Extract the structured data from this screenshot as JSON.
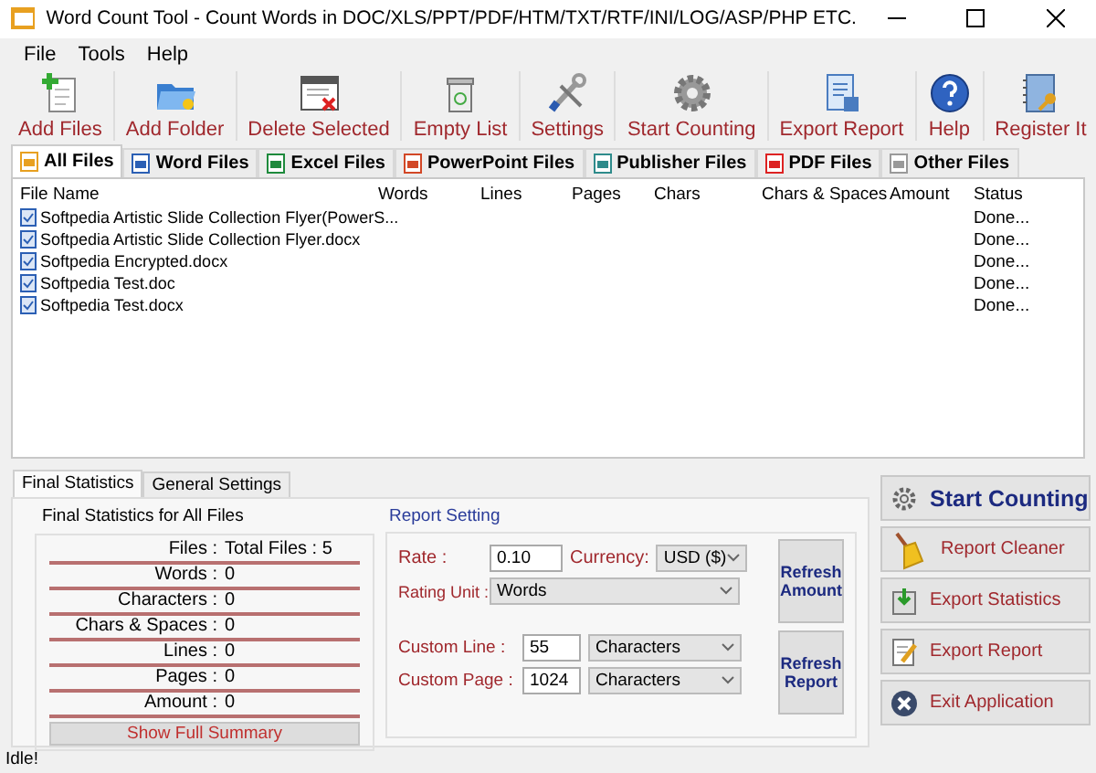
{
  "window": {
    "title": "Word Count Tool - Count Words in DOC/XLS/PPT/PDF/HTM/TXT/RTF/INI/LOG/ASP/PHP ETC."
  },
  "menu": [
    "File",
    "Tools",
    "Help"
  ],
  "toolbar": [
    {
      "label": "Add Files",
      "kind": "add-files"
    },
    {
      "label": "Add Folder",
      "kind": "add-folder"
    },
    {
      "label": "Delete Selected",
      "kind": "delete"
    },
    {
      "label": "Empty List",
      "kind": "empty"
    },
    {
      "label": "Settings",
      "kind": "settings"
    },
    {
      "label": "Start Counting",
      "kind": "start"
    },
    {
      "label": "Export Report",
      "kind": "export"
    },
    {
      "label": "Help",
      "kind": "help"
    },
    {
      "label": "Register It",
      "kind": "register"
    }
  ],
  "file_tabs": [
    {
      "label": "All Files",
      "kind": "all",
      "selected": true
    },
    {
      "label": "Word Files",
      "kind": "word",
      "selected": false
    },
    {
      "label": "Excel Files",
      "kind": "excel",
      "selected": false
    },
    {
      "label": "PowerPoint Files",
      "kind": "powerpoint",
      "selected": false
    },
    {
      "label": "Publisher Files",
      "kind": "publisher",
      "selected": false
    },
    {
      "label": "PDF Files",
      "kind": "pdf",
      "selected": false
    },
    {
      "label": "Other Files",
      "kind": "other",
      "selected": false
    }
  ],
  "table": {
    "columns": [
      "File Name",
      "Words",
      "Lines",
      "Pages",
      "Chars",
      "Chars & Spaces",
      "Amount",
      "Status"
    ],
    "rows": [
      {
        "file_name": "Softpedia Artistic Slide Collection Flyer(PowerS...",
        "status": "Done..."
      },
      {
        "file_name": "Softpedia Artistic Slide Collection Flyer.docx",
        "status": "Done..."
      },
      {
        "file_name": "Softpedia Encrypted.docx",
        "status": "Done..."
      },
      {
        "file_name": "Softpedia Test.doc",
        "status": "Done..."
      },
      {
        "file_name": "Softpedia Test.docx",
        "status": "Done..."
      }
    ]
  },
  "bottom_tabs": [
    {
      "label": "Final Statistics",
      "selected": true
    },
    {
      "label": "General Settings",
      "selected": false
    }
  ],
  "statistics": {
    "title": "Final Statistics for All Files",
    "rows": [
      {
        "label": "Files :",
        "value": "Total Files : 5"
      },
      {
        "label": "Words :",
        "value": "0"
      },
      {
        "label": "Characters :",
        "value": "0"
      },
      {
        "label": "Chars & Spaces :",
        "value": "0"
      },
      {
        "label": "Lines :",
        "value": "0"
      },
      {
        "label": "Pages :",
        "value": "0"
      },
      {
        "label": "Amount :",
        "value": "0"
      }
    ],
    "summary_button": "Show Full Summary"
  },
  "report_setting": {
    "title": "Report Setting",
    "rate": {
      "label": "Rate :",
      "value": "0.10"
    },
    "currency": {
      "label": "Currency:",
      "value": "USD ($)"
    },
    "rating_unit": {
      "label": "Rating Unit :",
      "value": "Words"
    },
    "custom_line": {
      "label": "Custom Line :",
      "value": "55",
      "unit": "Characters"
    },
    "custom_page": {
      "label": "Custom Page :",
      "value": "1024",
      "unit": "Characters"
    },
    "buttons": [
      "Refresh Amount",
      "Refresh Report"
    ]
  },
  "actions": [
    {
      "label": "Start Counting",
      "kind": "start"
    },
    {
      "label": "Report Cleaner",
      "kind": "cleaner"
    },
    {
      "label": "Export Statistics",
      "kind": "stats"
    },
    {
      "label": "Export Report",
      "kind": "report"
    },
    {
      "label": "Exit Application",
      "kind": "exit"
    }
  ],
  "status_bar": "Idle!"
}
